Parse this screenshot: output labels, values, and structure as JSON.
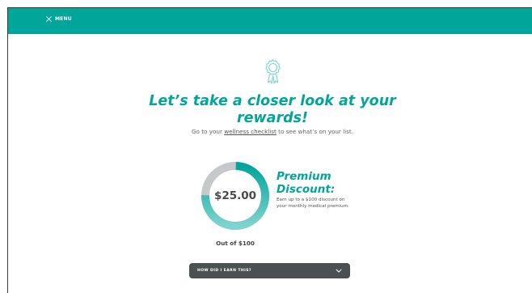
{
  "header": {
    "menu_label": "MENU",
    "menu_icon": "close-icon",
    "bar_color": "#02a59a"
  },
  "hero": {
    "icon": "ribbon-award-icon",
    "title": "Let’s take a closer look at your rewards!",
    "subtitle_prefix": "Go to your ",
    "subtitle_link": "wellness checklist",
    "subtitle_suffix": " to see what’s on your list."
  },
  "reward": {
    "amount": "$25.00",
    "earned_value": 25,
    "max_value": 100,
    "out_of_label": "Out of $100",
    "title": "Premium Discount:",
    "description": "Earn up to a $100 discount on your monthly medical premium.",
    "colors": {
      "earned": "#02a59a",
      "remaining": "#c5c9c9",
      "gradient_end": "#7fd3d0"
    }
  },
  "earn_toggle": {
    "label": "HOW DID I EARN THIS?",
    "icon": "chevron-down-icon"
  }
}
